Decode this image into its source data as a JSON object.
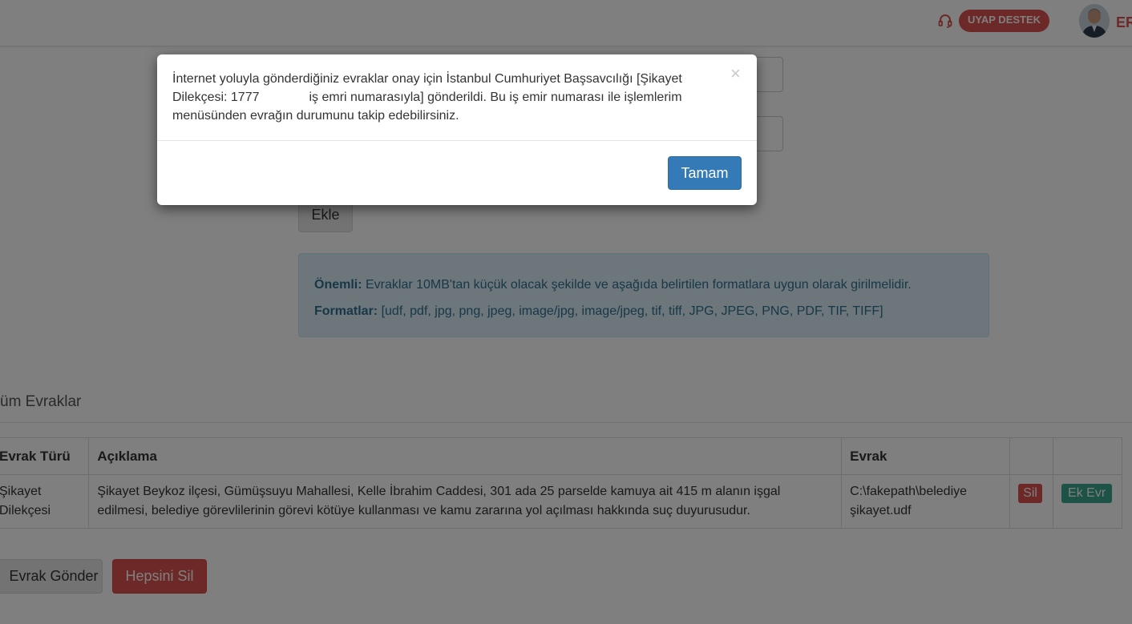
{
  "header": {
    "support_label": "UYAP DESTEK",
    "user_label": "ER"
  },
  "form": {
    "add_button": "Ekle"
  },
  "info": {
    "important_label": "Önemli:",
    "important_text": " Evraklar 10MB'tan küçük olacak şekilde ve aşağıda belirtilen formatlara uygun olarak girilmelidir.",
    "formats_label": "Formatlar:",
    "formats_text": " [udf, pdf, jpg, png, jpeg, image/jpg, image/jpeg, tif, tiff, JPG, JPEG, PNG, PDF, TIF, TIFF]"
  },
  "documents": {
    "title": "üm Evraklar",
    "headers": [
      "Evrak Türü",
      "Açıklama",
      "Evrak",
      "",
      ""
    ],
    "rows": [
      {
        "type": "Şikayet Dilekçesi",
        "description": "Şikayet Beykoz ilçesi, Gümüşsuyu Mahallesi, Kelle İbrahim Caddesi, 301 ada 25 parselde kamuya ait 415 m alanın işgal edilmesi, belediye görevlilerinin görevi kötüye kullanması ve kamu zararına yol açılması hakkında suç duyurusudur.",
        "file": "C:\\fakepath\\belediye şikayet.udf",
        "delete_label": "Sil",
        "attach_label": "Ek Evr"
      }
    ]
  },
  "actions": {
    "send_label": "Evrak Gönder",
    "delete_all_label": "Hepsini Sil"
  },
  "modal": {
    "message_part1": "İnternet yoluyla gönderdiğiniz evraklar onay için İstanbul Cumhuriyet Başsavcılığı [Şikayet Dilekçesi: 1777",
    "message_part2": "iş emri numarasıyla] gönderildi. Bu iş emir numarası ile işlemlerim menüsünden evrağın durumunu takip edebilirsiniz.",
    "close_symbol": "×",
    "ok_label": "Tamam"
  },
  "colors": {
    "danger": "#d9534f",
    "primary": "#337ab7",
    "info_bg": "#d9edf7",
    "info_text": "#31708f"
  }
}
